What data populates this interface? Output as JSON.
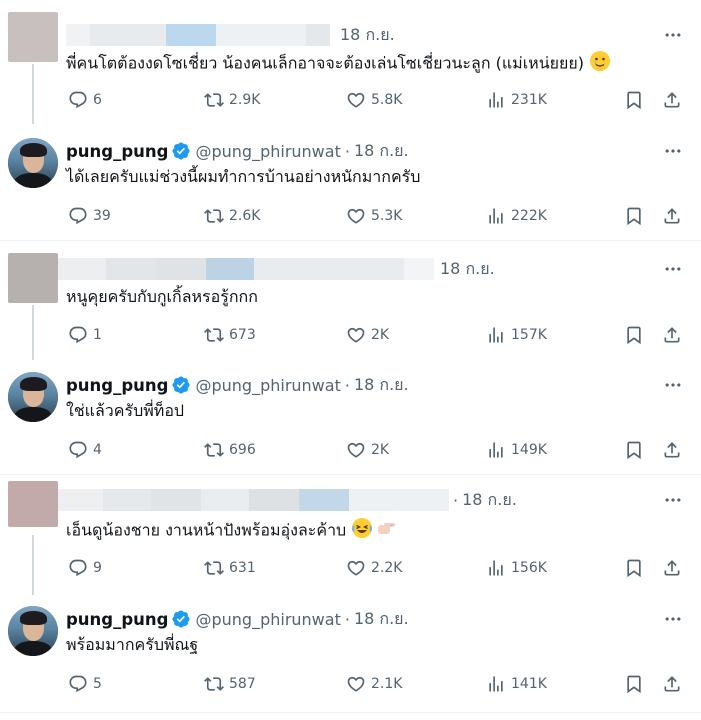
{
  "colors": {
    "text": "#0f1419",
    "muted": "#536471",
    "verified": "#1d9bf0",
    "divider": "#eff3f4",
    "thread": "#cfd9de"
  },
  "icons": {
    "reply": "reply-icon",
    "retweet": "retweet-icon",
    "like": "heart-icon",
    "views": "views-icon",
    "bookmark": "bookmark-icon",
    "share": "share-icon",
    "more": "more-icon"
  },
  "tweets": [
    {
      "time": "18 ก.ย.",
      "text": "พี่คนโตต้องงดโซเชี่ยว น้องคนเล็กอาจจะต้องเล่นโซเชี่ยวนะลูก (แม่เหน่ยยย)",
      "emoji": "face-with-tear-emoji",
      "stats": {
        "replies": "6",
        "retweets": "2.9K",
        "likes": "5.8K",
        "views": "231K"
      }
    },
    {
      "name": "pung_pung",
      "handle": "@pung_phirunwat",
      "sep": "·",
      "time": "18 ก.ย.",
      "text": "ได้เลยครับแม่ช่วงนี้ผมทำการบ้านอย่างหนักมากครับ",
      "stats": {
        "replies": "39",
        "retweets": "2.6K",
        "likes": "5.3K",
        "views": "222K"
      }
    },
    {
      "time": "18 ก.ย.",
      "text": "หนูคุยครับกับกูเกิ้ลหรอรู้กกก",
      "stats": {
        "replies": "1",
        "retweets": "673",
        "likes": "2K",
        "views": "157K"
      }
    },
    {
      "name": "pung_pung",
      "handle": "@pung_phirunwat",
      "sep": "·",
      "time": "18 ก.ย.",
      "text": "ใช่แล้วครับพี่ท็อป",
      "stats": {
        "replies": "4",
        "retweets": "696",
        "likes": "2K",
        "views": "149K"
      }
    },
    {
      "sep": "·",
      "time": "18 ก.ย.",
      "text": "เอ็นดูน้องชาย งานหน้าปังพร้อมอุ่งละค้าบ",
      "emoji": "laughing-and-pointing-hand-emoji",
      "stats": {
        "replies": "9",
        "retweets": "631",
        "likes": "2.2K",
        "views": "156K"
      }
    },
    {
      "name": "pung_pung",
      "handle": "@pung_phirunwat",
      "sep": "·",
      "time": "18 ก.ย.",
      "text": "พร้อมมากครับพี่ณฐ",
      "stats": {
        "replies": "5",
        "retweets": "587",
        "likes": "2.1K",
        "views": "141K"
      }
    }
  ]
}
